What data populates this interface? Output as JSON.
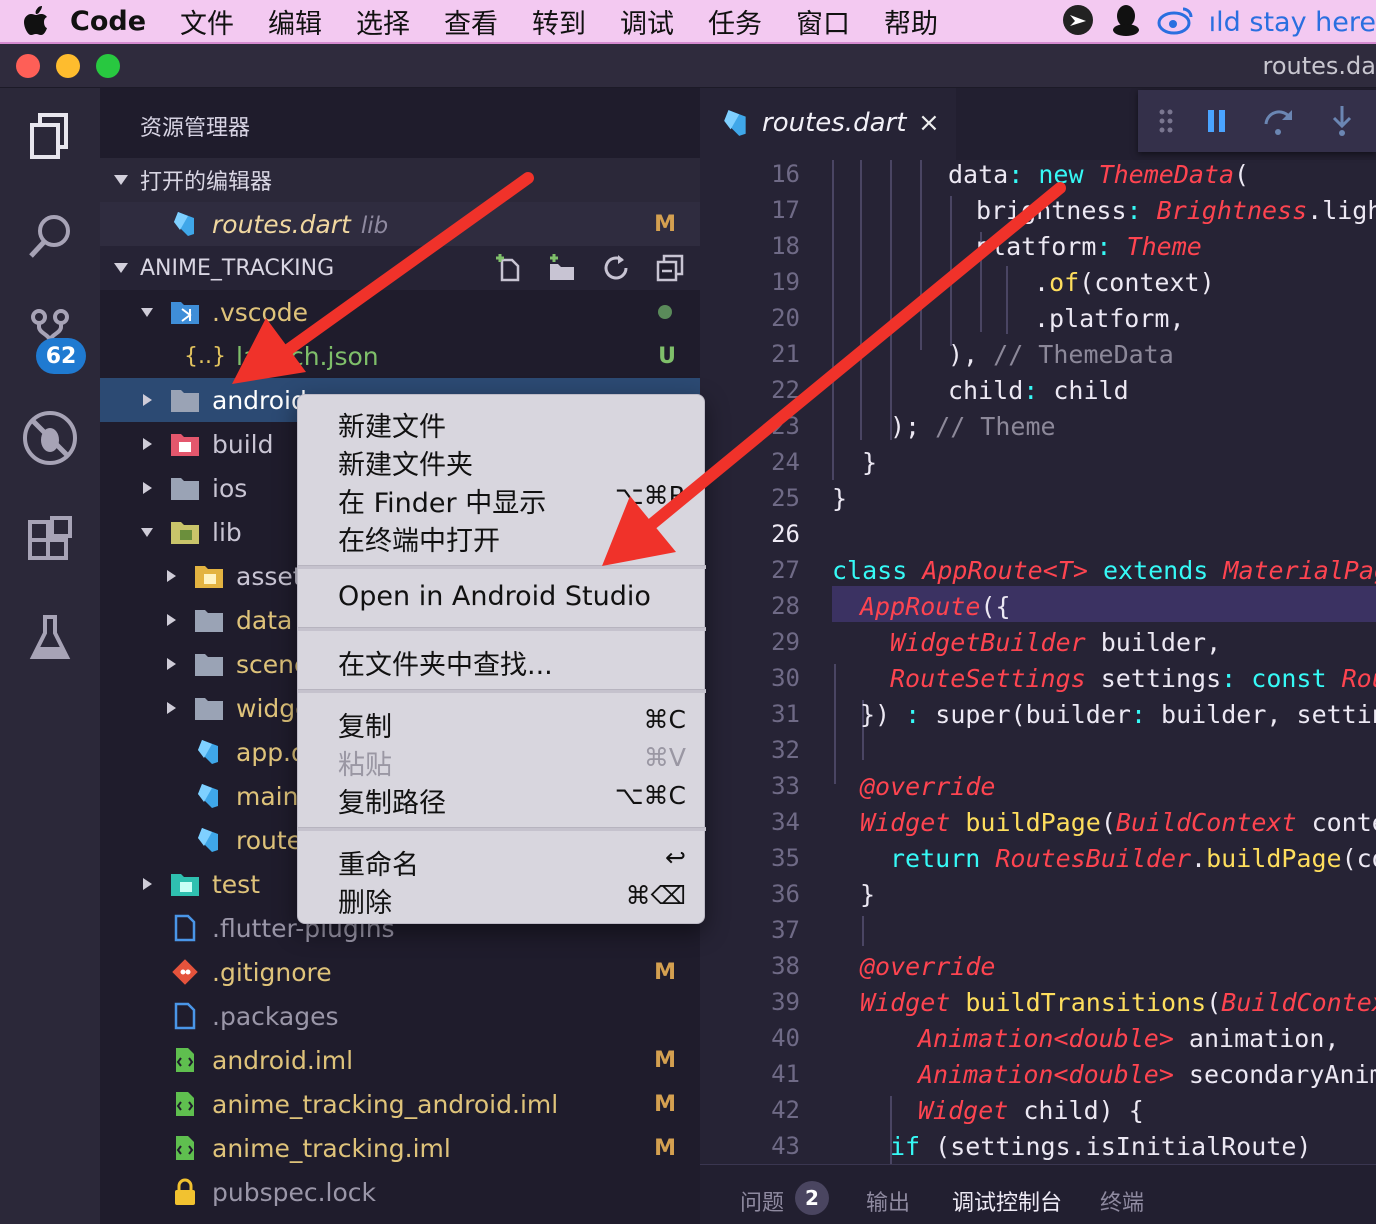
{
  "menubar": {
    "items": [
      "Code",
      "文件",
      "编辑",
      "选择",
      "查看",
      "转到",
      "调试",
      "任务",
      "窗口",
      "帮助"
    ],
    "tray_text": "ıld stay here"
  },
  "titlebar": {
    "title": "routes.da"
  },
  "activity": {
    "badge": "62"
  },
  "sidebar": {
    "title": "资源管理器",
    "open_editors_label": "打开的编辑器",
    "open_editor": {
      "name": "routes.dart",
      "folder": "lib",
      "status": "M"
    },
    "project_label": "ANIME_TRACKING",
    "tree": [
      {
        "name": ".vscode",
        "status": ""
      },
      {
        "name": "launch.json",
        "status": "U"
      },
      {
        "name": "android",
        "status": ""
      },
      {
        "name": "build",
        "status": ""
      },
      {
        "name": "ios",
        "status": ""
      },
      {
        "name": "lib",
        "status": ""
      },
      {
        "name": "assets",
        "status": ""
      },
      {
        "name": "data",
        "status": ""
      },
      {
        "name": "scenes",
        "status": ""
      },
      {
        "name": "widgets",
        "status": ""
      },
      {
        "name": "app.dart",
        "status": ""
      },
      {
        "name": "main.dart",
        "status": ""
      },
      {
        "name": "routes.dart",
        "status": ""
      },
      {
        "name": "test",
        "status": ""
      },
      {
        "name": ".flutter-plugins",
        "status": ""
      },
      {
        "name": ".gitignore",
        "status": "M"
      },
      {
        "name": ".packages",
        "status": ""
      },
      {
        "name": "android.iml",
        "status": "M"
      },
      {
        "name": "anime_tracking_android.iml",
        "status": "M"
      },
      {
        "name": "anime_tracking.iml",
        "status": "M"
      },
      {
        "name": "pubspec.lock",
        "status": ""
      }
    ]
  },
  "context_menu": {
    "new_file": "新建文件",
    "new_folder": "新建文件夹",
    "reveal_finder": "在 Finder 中显示",
    "reveal_finder_sc": "⌥⌘R",
    "open_terminal": "在终端中打开",
    "open_android_studio": "Open in Android Studio",
    "find_in_folder": "在文件夹中查找...",
    "copy": "复制",
    "copy_sc": "⌘C",
    "paste": "粘贴",
    "paste_sc": "⌘V",
    "copy_path": "复制路径",
    "copy_path_sc": "⌥⌘C",
    "rename": "重命名",
    "rename_sc": "↩",
    "delete": "删除",
    "delete_sc": "⌘⌫"
  },
  "editor": {
    "tab_name": "routes.dart",
    "tab_close": "×",
    "current_line": 26,
    "lines": [
      16,
      17,
      18,
      19,
      20,
      21,
      22,
      23,
      24,
      25,
      26,
      27,
      28,
      29,
      30,
      31,
      32,
      33,
      34,
      35,
      36,
      37,
      38,
      39,
      40,
      41,
      42,
      43
    ]
  },
  "panel": {
    "problems": "问题",
    "problems_count": "2",
    "output": "输出",
    "debug_console": "调试控制台",
    "terminal": "终端"
  },
  "colors": {
    "accent": "#1f7ad1",
    "keyword": "#36f9f6",
    "type": "#fe4450",
    "function": "#fede5d",
    "arrow": "#f0322a"
  }
}
